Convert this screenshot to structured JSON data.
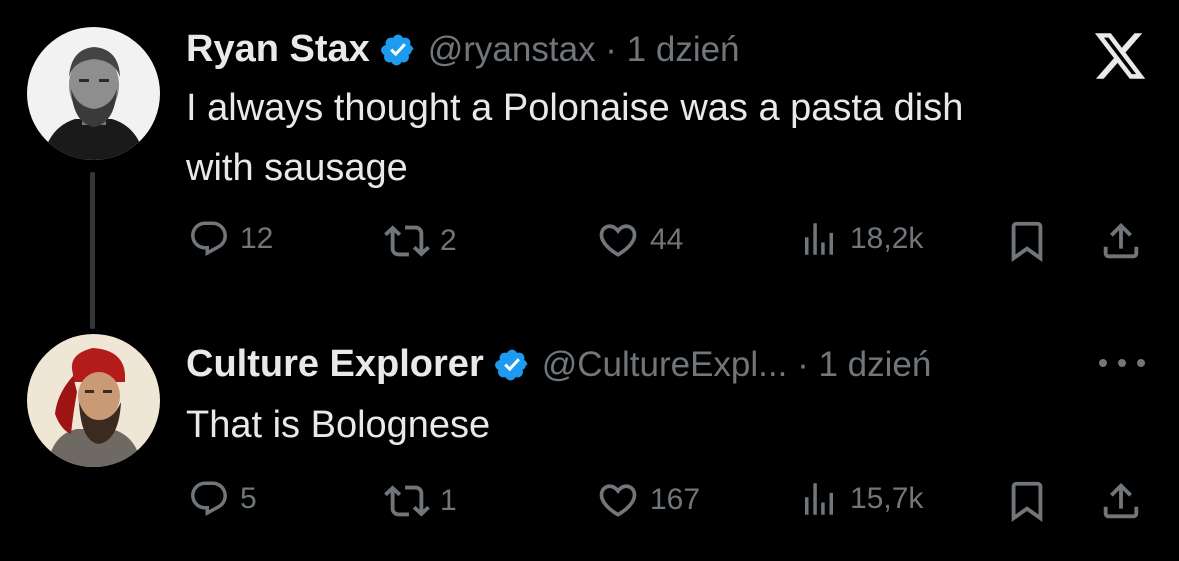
{
  "tweets": [
    {
      "name": "Ryan Stax",
      "meta": "@ryanstax · 1 dzień",
      "text_lines": [
        "I always thought a Polonaise was a pasta dish",
        "with sausage"
      ],
      "replies": "12",
      "retweets": "2",
      "likes": "44",
      "views": "18,2k",
      "avatar_desc": "man with beard, black and white"
    },
    {
      "name": "Culture Explorer",
      "meta": "@CultureExpl... · 1 dzień",
      "text_lines": [
        "That is Bolognese"
      ],
      "replies": "5",
      "retweets": "1",
      "likes": "167",
      "views": "15,7k",
      "avatar_desc": "painted portrait of bearded man in red hat"
    }
  ],
  "icons": {
    "verified": "verified-badge-icon",
    "reply": "reply-icon",
    "retweet": "retweet-icon",
    "like": "heart-icon",
    "views": "views-icon",
    "bookmark": "bookmark-icon",
    "share": "share-icon",
    "x_logo": "x-logo-icon",
    "more": "more-icon"
  },
  "colors": {
    "background": "#000000",
    "text": "#e7e9ea",
    "muted": "#71767b",
    "verified": "#1d9bf0",
    "thread_line": "#333639"
  }
}
